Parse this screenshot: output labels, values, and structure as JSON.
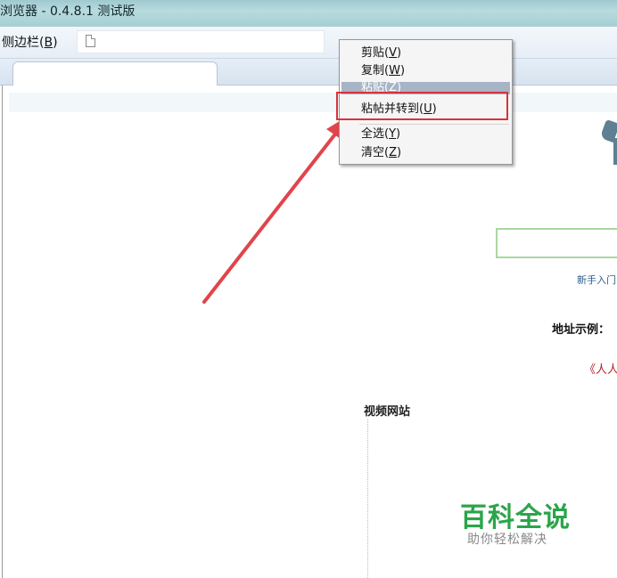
{
  "window": {
    "title": "浏览器 - 0.4.8.1 测试版"
  },
  "toolbar": {
    "sidebar_label": "侧边栏(",
    "sidebar_key": "B",
    "sidebar_close": ")"
  },
  "context_menu": {
    "items": [
      {
        "label": "剪贴(",
        "key": "V",
        "close": ")"
      },
      {
        "label": "复制(",
        "key": "W",
        "close": ")"
      },
      {
        "label": "粘贴(",
        "key": "Z",
        "close": ")"
      },
      {
        "label": "粘帖并转到(",
        "key": "U",
        "close": ")"
      },
      {
        "label": "全选(",
        "key": "Y",
        "close": ")"
      },
      {
        "label": "清空(",
        "key": "Z",
        "close": ")"
      }
    ],
    "highlight_color": "#d9333c"
  },
  "page": {
    "new_user_link": "新手入门",
    "address_example": "地址示例：",
    "red_link": "《人人",
    "video_heading": "视频网站"
  },
  "watermark": {
    "title": "百科全说",
    "subtitle": "助你轻松解决"
  }
}
